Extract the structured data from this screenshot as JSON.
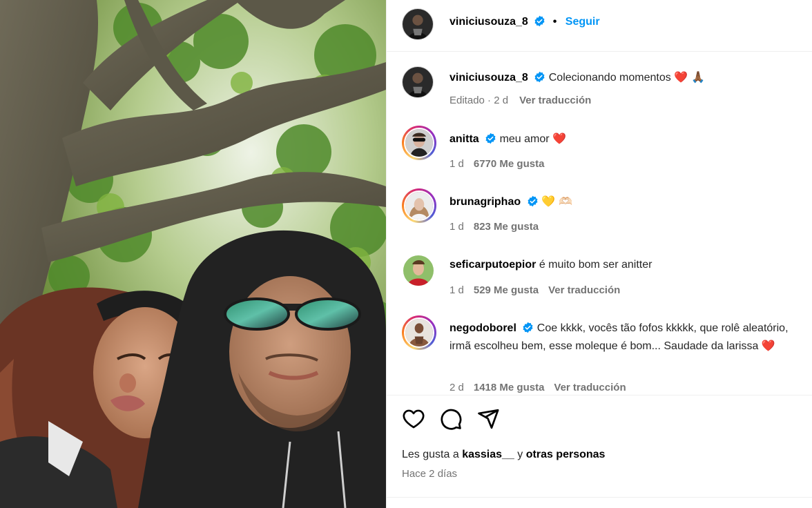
{
  "post": {
    "username": "viniciusouza_8",
    "follow_label": "Seguir",
    "separator": "•",
    "caption": {
      "username": "viniciusouza_8",
      "text": "Colecionando momentos",
      "emoji": "❤️ 🙏🏾",
      "edited": "Editado · 2 d",
      "translate": "Ver traducción"
    }
  },
  "comments": [
    {
      "username": "anitta",
      "verified": true,
      "text": "meu amor",
      "emoji": "❤️",
      "age": "1 d",
      "likes": "6770 Me gusta",
      "translate": ""
    },
    {
      "username": "brunagriphao",
      "verified": true,
      "text": "",
      "emoji": "💛 🫶🏻",
      "age": "1 d",
      "likes": "823 Me gusta",
      "translate": ""
    },
    {
      "username": "seficarputoepior",
      "verified": false,
      "text": "é muito bom ser anitter",
      "emoji": "",
      "age": "1 d",
      "likes": "529 Me gusta",
      "translate": "Ver traducción"
    },
    {
      "username": "negodoborel",
      "verified": true,
      "text": "Coe kkkk, vocês tão fofos kkkkk, que rolê aleatório, irmã escolheu bem, esse moleque é bom... Saudade da larissa",
      "emoji": "❤️",
      "age": "2 d",
      "likes": "1418 Me gusta",
      "translate": "Ver traducción"
    }
  ],
  "footer": {
    "likes_prefix": "Les gusta a",
    "liker": "kassias__",
    "likes_mid": "y",
    "likes_rest": "otras personas",
    "ago": "Hace 2 días"
  },
  "icons": [
    "heart-icon",
    "comment-icon",
    "share-icon",
    "verified-badge-icon"
  ],
  "colors": {
    "follow": "#0095f6",
    "verified": "#0095f6",
    "muted": "#737373"
  }
}
